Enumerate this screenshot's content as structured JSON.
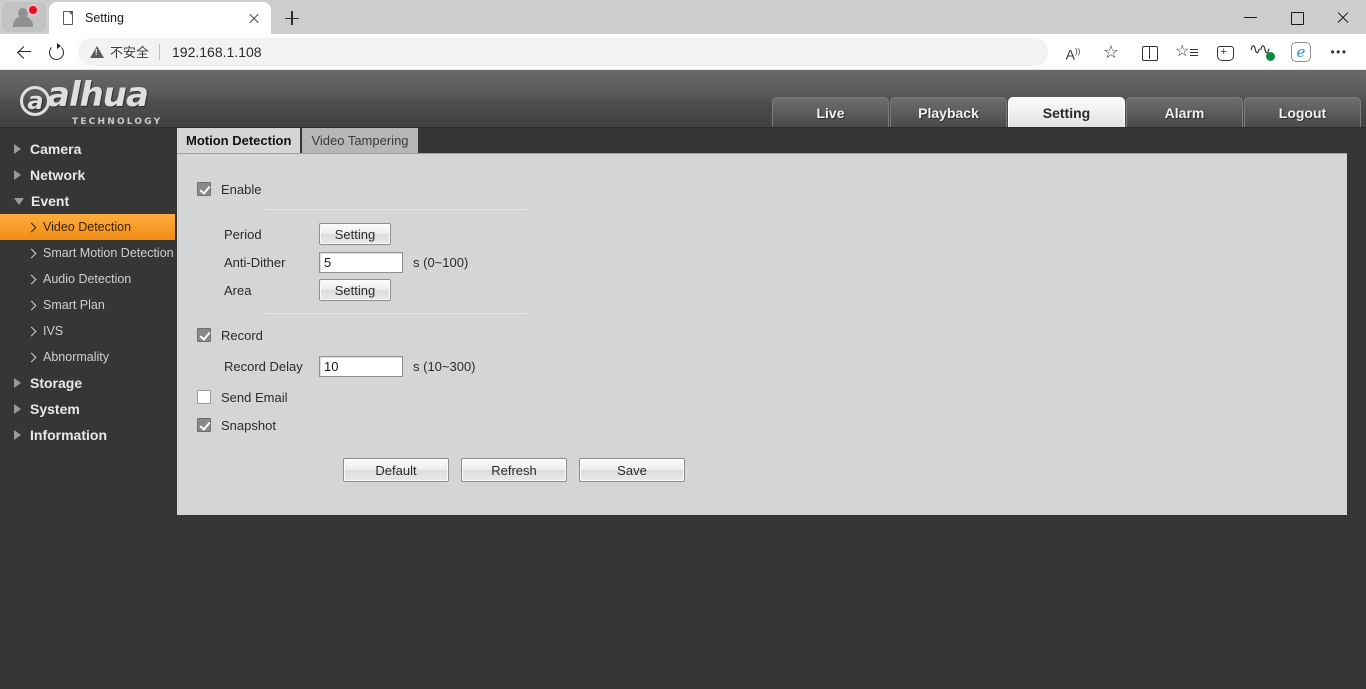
{
  "browser": {
    "tab": {
      "title": "Setting",
      "favicon": "page-icon"
    },
    "newtab_tooltip": "New tab",
    "address": {
      "security_label": "不安全",
      "url": "192.168.1.108"
    },
    "toolbar_icons": [
      "back-icon",
      "reload-icon",
      "read-aloud-icon",
      "favorite-star-icon",
      "split-screen-icon",
      "collections-icon",
      "add-tab-to-collection-icon",
      "browser-essentials-icon",
      "edge-copilot-icon",
      "settings-more-icon"
    ],
    "window_controls": [
      "minimize-icon",
      "maximize-icon",
      "close-icon"
    ]
  },
  "app": {
    "logo": {
      "brand": "alhua",
      "sub": "TECHNOLOGY"
    },
    "nav": [
      {
        "label": "Live",
        "active": false
      },
      {
        "label": "Playback",
        "active": false
      },
      {
        "label": "Setting",
        "active": true
      },
      {
        "label": "Alarm",
        "active": false
      },
      {
        "label": "Logout",
        "active": false
      }
    ]
  },
  "sidebar": {
    "groups": [
      {
        "label": "Camera",
        "expanded": false
      },
      {
        "label": "Network",
        "expanded": false
      },
      {
        "label": "Event",
        "expanded": true
      },
      {
        "label": "Storage",
        "expanded": false
      },
      {
        "label": "System",
        "expanded": false
      },
      {
        "label": "Information",
        "expanded": false
      }
    ],
    "event_items": [
      {
        "label": "Video Detection",
        "selected": true
      },
      {
        "label": "Smart Motion Detection",
        "selected": false
      },
      {
        "label": "Audio Detection",
        "selected": false
      },
      {
        "label": "Smart Plan",
        "selected": false
      },
      {
        "label": "IVS",
        "selected": false
      },
      {
        "label": "Abnormality",
        "selected": false
      }
    ]
  },
  "content": {
    "tabs": [
      {
        "label": "Motion Detection",
        "active": true
      },
      {
        "label": "Video Tampering",
        "active": false
      }
    ],
    "enable": {
      "label": "Enable",
      "checked": true
    },
    "fields": {
      "period": {
        "label": "Period",
        "button": "Setting"
      },
      "anti_dither": {
        "label": "Anti-Dither",
        "value": "5",
        "unit": "s (0~100)"
      },
      "area": {
        "label": "Area",
        "button": "Setting"
      },
      "record": {
        "label": "Record",
        "checked": true
      },
      "record_delay": {
        "label": "Record Delay",
        "value": "10",
        "unit": "s (10~300)"
      },
      "send_email": {
        "label": "Send Email",
        "checked": false
      },
      "snapshot": {
        "label": "Snapshot",
        "checked": true
      }
    },
    "actions": [
      {
        "label": "Default"
      },
      {
        "label": "Refresh"
      },
      {
        "label": "Save"
      }
    ]
  },
  "colors": {
    "accent_selected": "#f28c15",
    "page_bg": "#363636",
    "panel_bg": "#d4d5d6",
    "header_gradient_top": "#6a6a6a"
  }
}
